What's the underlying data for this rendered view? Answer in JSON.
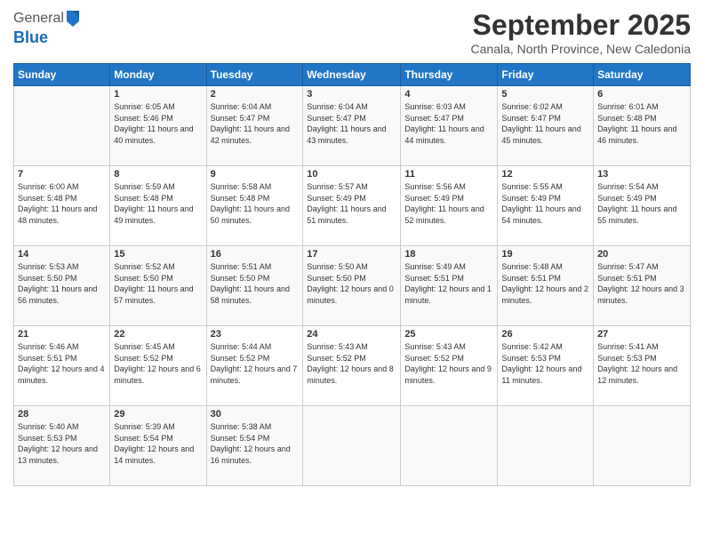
{
  "header": {
    "logo_line1": "General",
    "logo_line2": "Blue",
    "month": "September 2025",
    "location": "Canala, North Province, New Caledonia"
  },
  "weekdays": [
    "Sunday",
    "Monday",
    "Tuesday",
    "Wednesday",
    "Thursday",
    "Friday",
    "Saturday"
  ],
  "weeks": [
    [
      {
        "day": "",
        "info": ""
      },
      {
        "day": "1",
        "info": "Sunrise: 6:05 AM\nSunset: 5:46 PM\nDaylight: 11 hours\nand 40 minutes."
      },
      {
        "day": "2",
        "info": "Sunrise: 6:04 AM\nSunset: 5:47 PM\nDaylight: 11 hours\nand 42 minutes."
      },
      {
        "day": "3",
        "info": "Sunrise: 6:04 AM\nSunset: 5:47 PM\nDaylight: 11 hours\nand 43 minutes."
      },
      {
        "day": "4",
        "info": "Sunrise: 6:03 AM\nSunset: 5:47 PM\nDaylight: 11 hours\nand 44 minutes."
      },
      {
        "day": "5",
        "info": "Sunrise: 6:02 AM\nSunset: 5:47 PM\nDaylight: 11 hours\nand 45 minutes."
      },
      {
        "day": "6",
        "info": "Sunrise: 6:01 AM\nSunset: 5:48 PM\nDaylight: 11 hours\nand 46 minutes."
      }
    ],
    [
      {
        "day": "7",
        "info": "Sunrise: 6:00 AM\nSunset: 5:48 PM\nDaylight: 11 hours\nand 48 minutes."
      },
      {
        "day": "8",
        "info": "Sunrise: 5:59 AM\nSunset: 5:48 PM\nDaylight: 11 hours\nand 49 minutes."
      },
      {
        "day": "9",
        "info": "Sunrise: 5:58 AM\nSunset: 5:48 PM\nDaylight: 11 hours\nand 50 minutes."
      },
      {
        "day": "10",
        "info": "Sunrise: 5:57 AM\nSunset: 5:49 PM\nDaylight: 11 hours\nand 51 minutes."
      },
      {
        "day": "11",
        "info": "Sunrise: 5:56 AM\nSunset: 5:49 PM\nDaylight: 11 hours\nand 52 minutes."
      },
      {
        "day": "12",
        "info": "Sunrise: 5:55 AM\nSunset: 5:49 PM\nDaylight: 11 hours\nand 54 minutes."
      },
      {
        "day": "13",
        "info": "Sunrise: 5:54 AM\nSunset: 5:49 PM\nDaylight: 11 hours\nand 55 minutes."
      }
    ],
    [
      {
        "day": "14",
        "info": "Sunrise: 5:53 AM\nSunset: 5:50 PM\nDaylight: 11 hours\nand 56 minutes."
      },
      {
        "day": "15",
        "info": "Sunrise: 5:52 AM\nSunset: 5:50 PM\nDaylight: 11 hours\nand 57 minutes."
      },
      {
        "day": "16",
        "info": "Sunrise: 5:51 AM\nSunset: 5:50 PM\nDaylight: 11 hours\nand 58 minutes."
      },
      {
        "day": "17",
        "info": "Sunrise: 5:50 AM\nSunset: 5:50 PM\nDaylight: 12 hours\nand 0 minutes."
      },
      {
        "day": "18",
        "info": "Sunrise: 5:49 AM\nSunset: 5:51 PM\nDaylight: 12 hours\nand 1 minute."
      },
      {
        "day": "19",
        "info": "Sunrise: 5:48 AM\nSunset: 5:51 PM\nDaylight: 12 hours\nand 2 minutes."
      },
      {
        "day": "20",
        "info": "Sunrise: 5:47 AM\nSunset: 5:51 PM\nDaylight: 12 hours\nand 3 minutes."
      }
    ],
    [
      {
        "day": "21",
        "info": "Sunrise: 5:46 AM\nSunset: 5:51 PM\nDaylight: 12 hours\nand 4 minutes."
      },
      {
        "day": "22",
        "info": "Sunrise: 5:45 AM\nSunset: 5:52 PM\nDaylight: 12 hours\nand 6 minutes."
      },
      {
        "day": "23",
        "info": "Sunrise: 5:44 AM\nSunset: 5:52 PM\nDaylight: 12 hours\nand 7 minutes."
      },
      {
        "day": "24",
        "info": "Sunrise: 5:43 AM\nSunset: 5:52 PM\nDaylight: 12 hours\nand 8 minutes."
      },
      {
        "day": "25",
        "info": "Sunrise: 5:43 AM\nSunset: 5:52 PM\nDaylight: 12 hours\nand 9 minutes."
      },
      {
        "day": "26",
        "info": "Sunrise: 5:42 AM\nSunset: 5:53 PM\nDaylight: 12 hours\nand 11 minutes."
      },
      {
        "day": "27",
        "info": "Sunrise: 5:41 AM\nSunset: 5:53 PM\nDaylight: 12 hours\nand 12 minutes."
      }
    ],
    [
      {
        "day": "28",
        "info": "Sunrise: 5:40 AM\nSunset: 5:53 PM\nDaylight: 12 hours\nand 13 minutes."
      },
      {
        "day": "29",
        "info": "Sunrise: 5:39 AM\nSunset: 5:54 PM\nDaylight: 12 hours\nand 14 minutes."
      },
      {
        "day": "30",
        "info": "Sunrise: 5:38 AM\nSunset: 5:54 PM\nDaylight: 12 hours\nand 16 minutes."
      },
      {
        "day": "",
        "info": ""
      },
      {
        "day": "",
        "info": ""
      },
      {
        "day": "",
        "info": ""
      },
      {
        "day": "",
        "info": ""
      }
    ]
  ]
}
